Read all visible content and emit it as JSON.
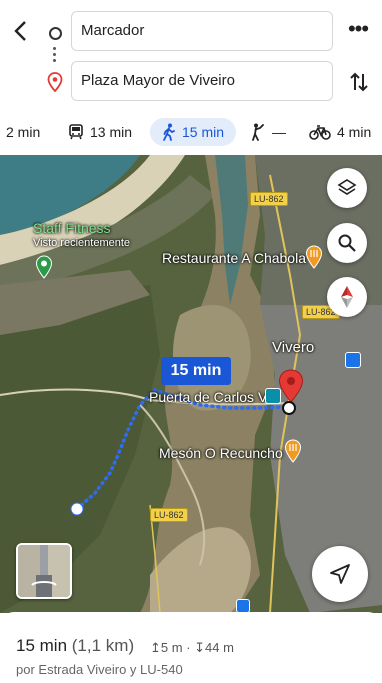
{
  "header": {
    "origin": "Marcador",
    "destination": "Plaza Mayor de Viveiro"
  },
  "modes": [
    {
      "icon": "car-icon",
      "label": "2 min"
    },
    {
      "icon": "transit-icon",
      "label": "13 min"
    },
    {
      "icon": "walk-icon",
      "label": "15 min",
      "active": true
    },
    {
      "icon": "rideshare-icon",
      "label": "—"
    },
    {
      "icon": "bike-icon",
      "label": "4 min"
    }
  ],
  "map": {
    "labels": {
      "staff_fitness": "Staff Fitness",
      "visto": "Visto recientemente",
      "restaurante": "Restaurante A Chabola",
      "vivero": "Vivero",
      "puerta": "Puerta de Carlos V",
      "meson": "Mesón O Recuncho"
    },
    "roads": {
      "lu862_top": "LU-862",
      "lu862_bottom": "LU-862"
    },
    "eta_badge": "15 min"
  },
  "sheet": {
    "time": "15 min",
    "distance": "(1,1 km)",
    "up": "5 m",
    "down": "44 m",
    "via": "por Estrada Viveiro y LU-540"
  },
  "colors": {
    "accent": "#1a57d6",
    "route": "#2f6cf2",
    "pin": "#e53935"
  }
}
